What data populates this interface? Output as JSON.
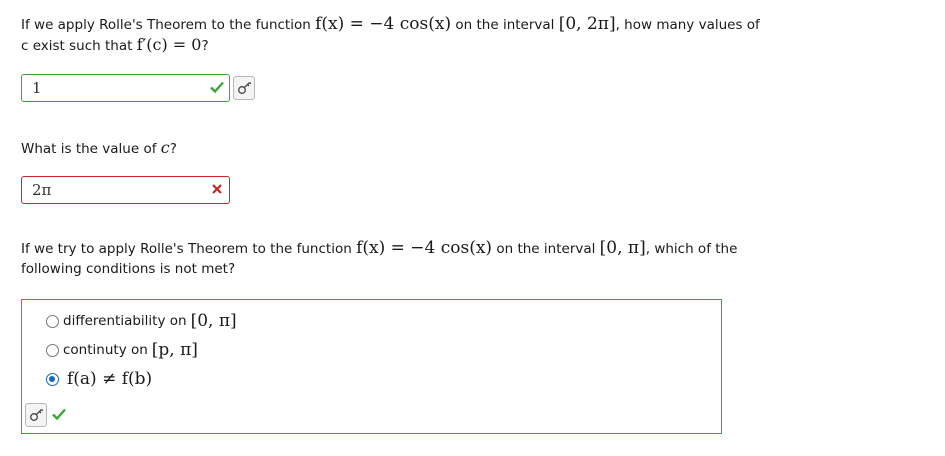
{
  "question1": {
    "text_a": "If we apply Rolle's Theorem to the function ",
    "func": "f(x) = −4 cos(x)",
    "text_b": " on the interval ",
    "interval": "[0, 2π]",
    "text_c": ", how many values of",
    "line2_a": "c exist such that ",
    "line2_math": "f′(c) = 0",
    "line2_end": "?"
  },
  "answer1": {
    "value": "1",
    "status": "correct"
  },
  "question2": {
    "text": "What is the value of ",
    "var": "c",
    "end": "?"
  },
  "answer2": {
    "value": "2π",
    "status": "incorrect"
  },
  "question3": {
    "text_a": "If we try to apply Rolle's Theorem to the function ",
    "func": "f(x) = −4 cos(x)",
    "text_b": " on the interval ",
    "interval": "[0, π]",
    "text_c": ", which of the",
    "line2": "following conditions is not met?"
  },
  "choices": [
    {
      "text": "differentiability on ",
      "math": "[0, π]",
      "selected": false
    },
    {
      "text": "continuty on ",
      "math": "[p, π]",
      "selected": false
    },
    {
      "text": "",
      "math": "f(a) ≠ f(b)",
      "selected": true
    }
  ],
  "colors": {
    "correct": "#3aa63a",
    "incorrect": "#c62828",
    "selected": "#1565c0"
  },
  "icons": {
    "correct": "check-icon",
    "incorrect": "x-mark-icon",
    "key": "key-icon"
  }
}
